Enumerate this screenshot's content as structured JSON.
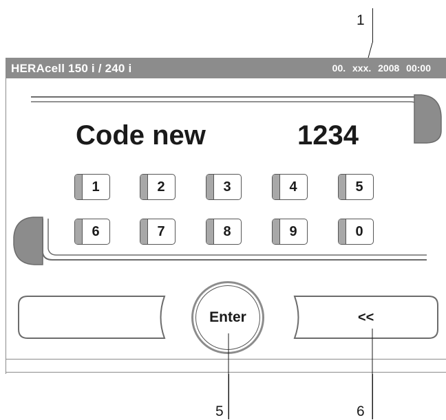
{
  "header": {
    "title": "HERAcell 150 i / 240 i",
    "datetime": "00. xxx. 2008   00:00"
  },
  "code": {
    "label": "Code new",
    "value": "1234"
  },
  "keypad": {
    "keys": [
      "1",
      "2",
      "3",
      "4",
      "5",
      "6",
      "7",
      "8",
      "9",
      "0"
    ]
  },
  "buttons": {
    "left_label": "",
    "enter_label": "Enter",
    "back_label": "<<"
  },
  "callouts": {
    "c1": "1",
    "c5": "5",
    "c6": "6"
  }
}
